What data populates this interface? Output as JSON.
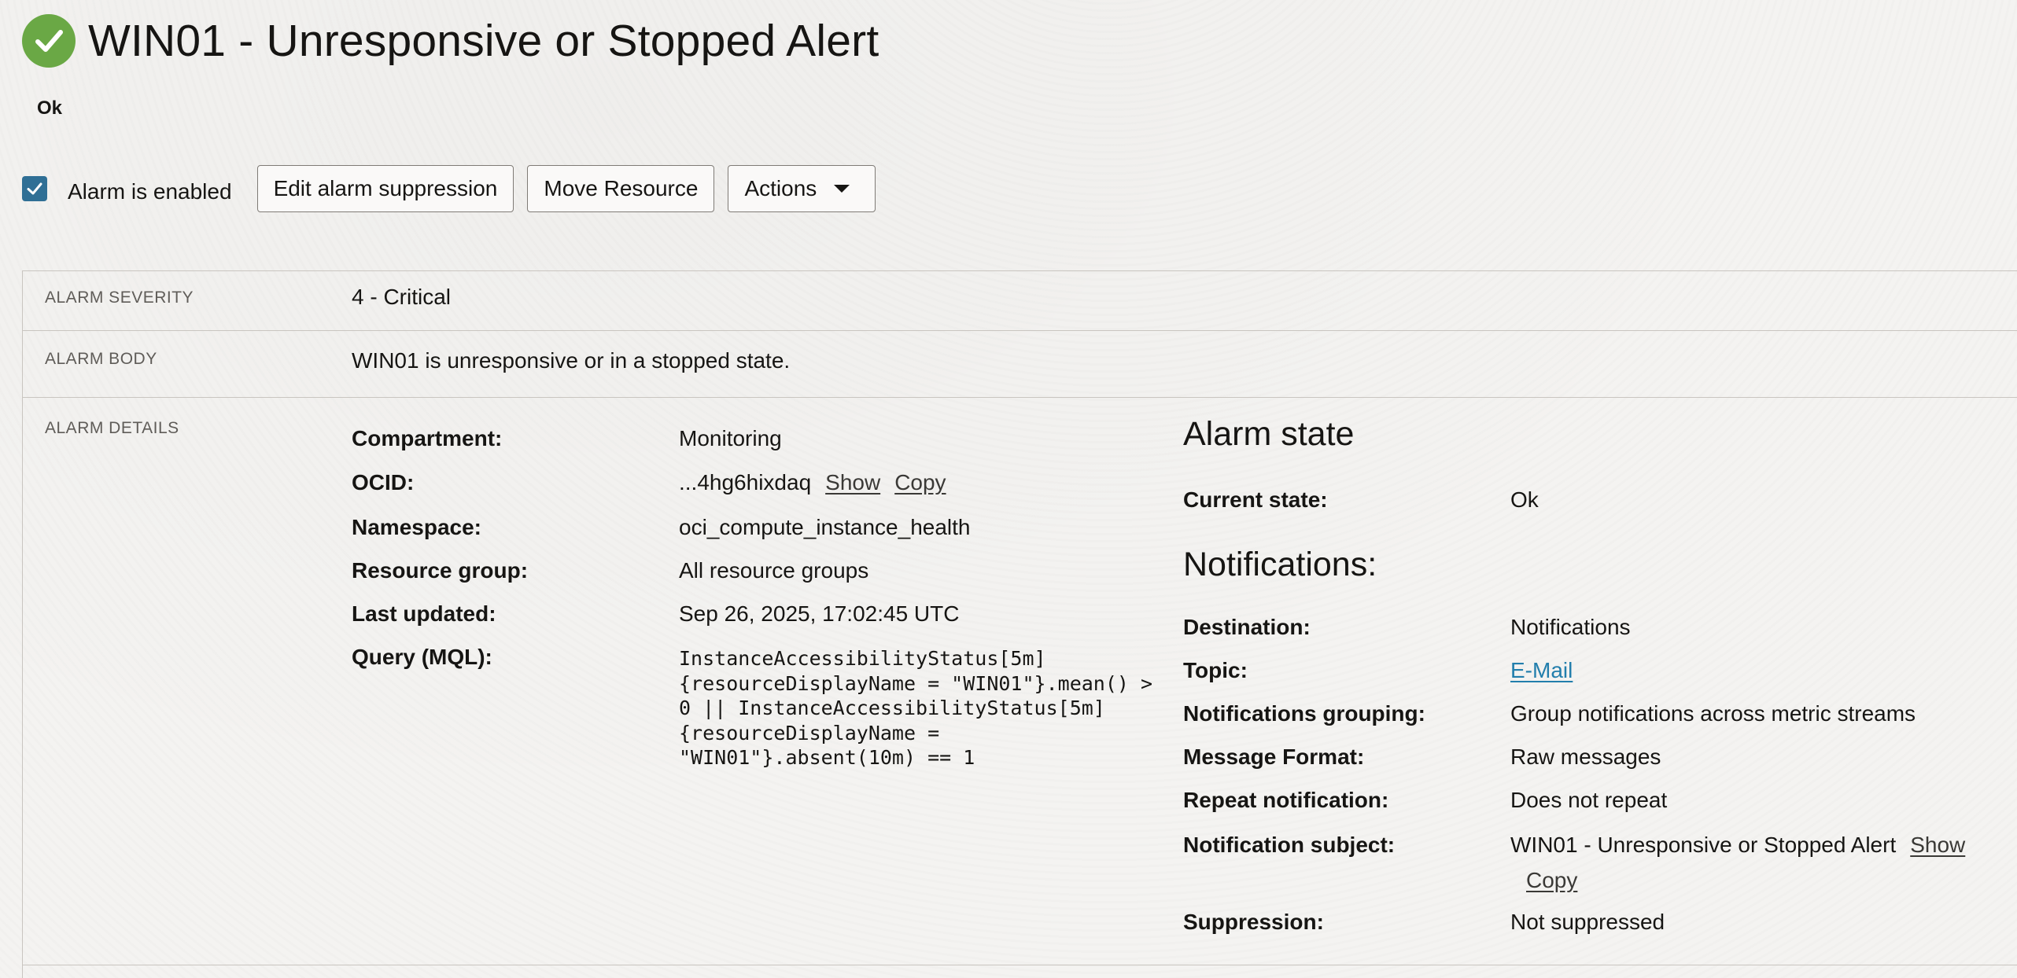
{
  "header": {
    "title": "WIN01 - Unresponsive or Stopped Alert",
    "state": "Ok",
    "status_icon": "check-circle-icon",
    "status_color": "#6aa845"
  },
  "toolbar": {
    "enabled_label": "Alarm is enabled",
    "enabled_checked": true,
    "edit_suppression_label": "Edit alarm suppression",
    "move_resource_label": "Move Resource",
    "actions_label": "Actions"
  },
  "severity": {
    "label": "ALARM SEVERITY",
    "value": "4 - Critical"
  },
  "body": {
    "label": "ALARM BODY",
    "value": "WIN01 is unresponsive or in a stopped state."
  },
  "details": {
    "label": "ALARM DETAILS",
    "compartment": {
      "key": "Compartment:",
      "value": "Monitoring"
    },
    "ocid": {
      "key": "OCID:",
      "value": "...4hg6hixdaq",
      "show": "Show",
      "copy": "Copy"
    },
    "namespace": {
      "key": "Namespace:",
      "value": "oci_compute_instance_health"
    },
    "resource_group": {
      "key": "Resource group:",
      "value": "All resource groups"
    },
    "last_updated": {
      "key": "Last updated:",
      "value": "Sep 26, 2025, 17:02:45 UTC"
    },
    "query": {
      "key": "Query (MQL):",
      "lines": [
        "InstanceAccessibilityStatus[5m]",
        "{resourceDisplayName = \"WIN01\"}.mean() >",
        "0 || InstanceAccessibilityStatus[5m]",
        "{resourceDisplayName =",
        "\"WIN01\"}.absent(10m) == 1"
      ]
    }
  },
  "alarm_state": {
    "heading": "Alarm state",
    "current_state": {
      "key": "Current state:",
      "value": "Ok"
    }
  },
  "notifications": {
    "heading": "Notifications:",
    "destination": {
      "key": "Destination:",
      "value": "Notifications"
    },
    "topic": {
      "key": "Topic:",
      "value": "E-Mail"
    },
    "grouping": {
      "key": "Notifications grouping:",
      "value": "Group notifications across metric streams"
    },
    "format": {
      "key": "Message Format:",
      "value": "Raw messages"
    },
    "repeat": {
      "key": "Repeat notification:",
      "value": "Does not repeat"
    },
    "subject": {
      "key": "Notification subject:",
      "value": "WIN01 - Unresponsive or Stopped Alert",
      "show": "Show",
      "copy": "Copy"
    },
    "suppression": {
      "key": "Suppression:",
      "value": "Not suppressed"
    }
  }
}
